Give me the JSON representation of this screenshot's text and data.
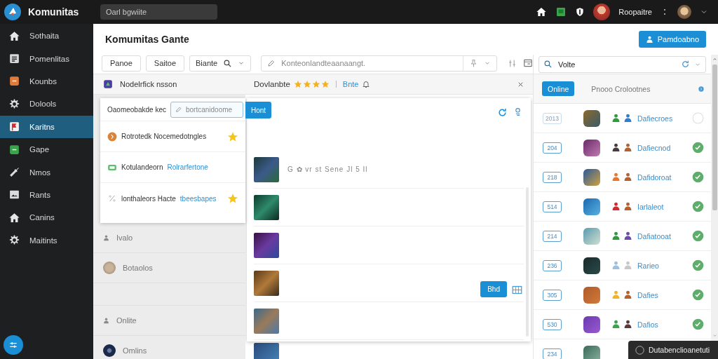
{
  "topbar": {
    "app_name": "Komunitas",
    "search": {
      "placeholder": "Oarl bgwiite"
    },
    "user_name": "Roopaitre"
  },
  "sidebar": {
    "items": [
      {
        "label": "Sothaita",
        "selected": false
      },
      {
        "label": "Pomenlitas",
        "selected": false
      },
      {
        "label": "Kounbs",
        "selected": false
      },
      {
        "label": "Dolools",
        "selected": false
      },
      {
        "label": "Karitns",
        "selected": true
      },
      {
        "label": "Gape",
        "selected": false
      },
      {
        "label": "Nmos",
        "selected": false
      },
      {
        "label": "Rants",
        "selected": false
      },
      {
        "label": "Canins",
        "selected": false
      },
      {
        "label": "Maitints",
        "selected": false
      }
    ]
  },
  "page": {
    "title": "Komumitas Gante",
    "primary_button": "Pamdoabno"
  },
  "toolbar": {
    "buttons": [
      "Panoe",
      "Saitoe"
    ],
    "dropdown": "Biante",
    "search": {
      "placeholder": "Konteonlandteaanaangt."
    }
  },
  "left_panel": {
    "header": "Nodelrfick nsson",
    "popup": {
      "label": "Oaomeobakde kec",
      "field": {
        "placeholder": "bortcanidoome"
      },
      "button": "Hont",
      "items": [
        {
          "kind": "coin",
          "text": "Rotrotedk Nocemedotngles",
          "starred": true
        },
        {
          "kind": "card",
          "text": "Kotulandeorn",
          "link": "Rolrarfertone",
          "starred": false
        },
        {
          "kind": "percent",
          "text": "lonthaleors Hacte",
          "link": "tbeesbapes",
          "starred": true
        }
      ]
    },
    "rows": [
      {
        "kind": "icon",
        "text": "Ivalo"
      },
      {
        "kind": "avatar",
        "text": "Botaolos"
      },
      {
        "kind": "blank"
      },
      {
        "kind": "icon",
        "text": "Onlite"
      },
      {
        "kind": "avatar",
        "text": "Omlins"
      }
    ]
  },
  "middle_panel": {
    "title": "Dovlanbte",
    "stars": 4,
    "link": "Bnte",
    "modal": {
      "button": "Bhd",
      "rows": [
        {
          "kind": "captioned",
          "caption": "G ✿ vr st Sene Jl 5 Il"
        },
        {
          "kind": "plain"
        },
        {
          "kind": "plain"
        },
        {
          "kind": "plain"
        },
        {
          "kind": "plain"
        }
      ]
    },
    "rows_behind": [
      {
        "kind": "plain"
      }
    ]
  },
  "right_panel": {
    "search": {
      "value": "Volte"
    },
    "tabs": [
      {
        "label": "Online",
        "selected": true
      },
      {
        "label": "Pnooo Crolootnes",
        "selected": false
      }
    ],
    "rows": [
      {
        "badge": "2013",
        "dimmed": true,
        "link": "Dafiecroes",
        "checked": false,
        "markers": [
          {
            "color": "#2e9b3f"
          },
          {
            "color": "#2f7fd0"
          }
        ]
      },
      {
        "badge": "204",
        "dimmed": false,
        "link": "Dafiecnod",
        "checked": true,
        "markers": [
          {
            "color": "#4a3a3a"
          },
          {
            "color": "#b5602f"
          }
        ]
      },
      {
        "badge": "218",
        "dimmed": false,
        "link": "Dafidoroat",
        "checked": true,
        "markers": [
          {
            "color": "#e8772e"
          },
          {
            "color": "#b5602f"
          }
        ]
      },
      {
        "badge": "514",
        "dimmed": false,
        "link": "Iarlaleot",
        "checked": true,
        "markers": [
          {
            "color": "#d6282e"
          },
          {
            "color": "#b5602f"
          }
        ]
      },
      {
        "badge": "214",
        "dimmed": false,
        "link": "Dafiatooat",
        "checked": true,
        "markers": [
          {
            "color": "#2e9b3f"
          },
          {
            "color": "#6a4bb0"
          }
        ]
      },
      {
        "badge": "236",
        "dimmed": false,
        "link": "Rarieo",
        "checked": true,
        "markers": [
          {
            "color": "#9fbfe0"
          },
          {
            "color": "#c8c8c8"
          }
        ]
      },
      {
        "badge": "305",
        "dimmed": false,
        "link": "Dafies",
        "checked": true,
        "markers": [
          {
            "color": "#f0b429"
          },
          {
            "color": "#b5602f"
          }
        ]
      },
      {
        "badge": "530",
        "dimmed": false,
        "link": "Dafios",
        "checked": true,
        "markers": [
          {
            "color": "#3aa44a"
          },
          {
            "color": "#5a3a3a"
          }
        ]
      },
      {
        "badge": "234",
        "dimmed": false,
        "markers": []
      }
    ]
  },
  "toast": {
    "text": "Dutabenclioanetuti"
  }
}
